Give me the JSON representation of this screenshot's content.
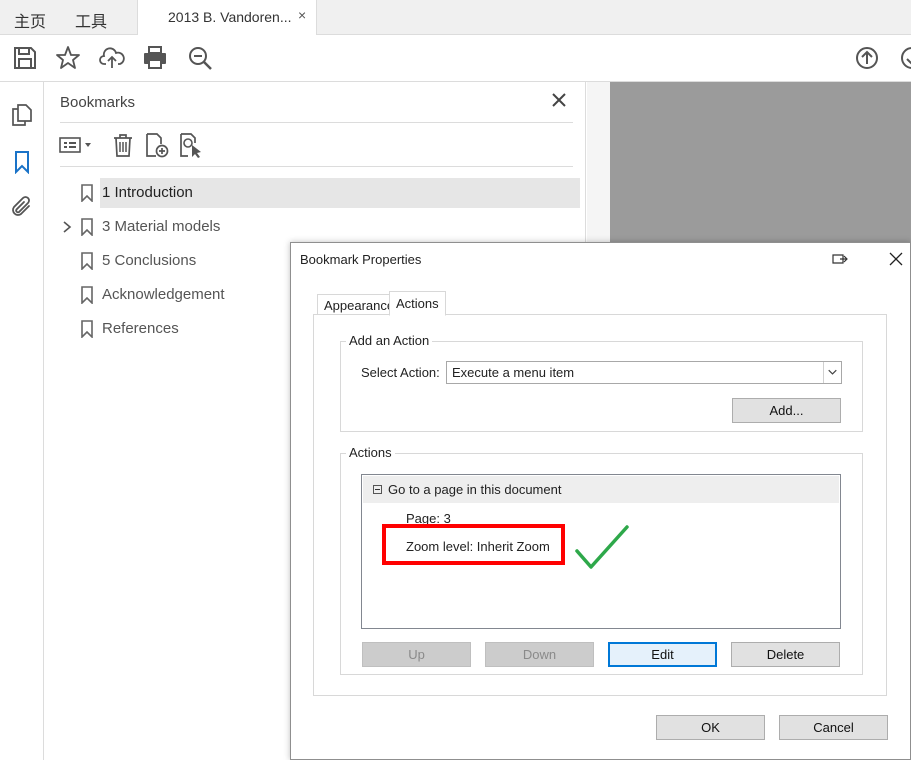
{
  "tabs": {
    "home": "主页",
    "tools": "工具",
    "document": "2013 B. Vandoren...",
    "close_symbol": "×"
  },
  "toolbar_icons": [
    "save-icon",
    "star-icon",
    "cloud-upload-icon",
    "print-icon",
    "zoom-search-icon",
    "page-up-icon",
    "page-down-icon"
  ],
  "rail_icons": [
    "pages-icon",
    "bookmark-icon",
    "attachment-icon"
  ],
  "bookmarks": {
    "title": "Bookmarks",
    "tool_icons": [
      "options-menu-icon",
      "delete-icon",
      "new-bookmark-icon",
      "new-bookmark-from-structure-icon"
    ],
    "items": [
      {
        "label": "1 Introduction",
        "selected": true,
        "expandable": false
      },
      {
        "label": "3 Material models",
        "selected": false,
        "expandable": true
      },
      {
        "label": "5 Conclusions",
        "selected": false,
        "expandable": false
      },
      {
        "label": "Acknowledgement",
        "selected": false,
        "expandable": false
      },
      {
        "label": "References",
        "selected": false,
        "expandable": false
      }
    ]
  },
  "dialog": {
    "title": "Bookmark Properties",
    "tabs": [
      "Appearance",
      "Actions"
    ],
    "active_tab": "Actions",
    "add_action": {
      "group_label": "Add an Action",
      "select_label": "Select Action:",
      "select_value": "Execute a menu item",
      "add_button": "Add..."
    },
    "actions": {
      "group_label": "Actions",
      "tree": {
        "heading": "Go to a page in this document",
        "rows": [
          "Page: 3",
          "Zoom level: Inherit Zoom"
        ]
      },
      "buttons": {
        "up": "Up",
        "down": "Down",
        "edit": "Edit",
        "delete": "Delete"
      }
    },
    "footer": {
      "ok": "OK",
      "cancel": "Cancel"
    }
  },
  "annotations": {
    "highlight_color": "#ff0000",
    "check_color": "#2ea84a"
  },
  "colors": {
    "accent": "#1a73c8",
    "focus": "#0078d7",
    "page_gray": "#9b9b9b"
  }
}
